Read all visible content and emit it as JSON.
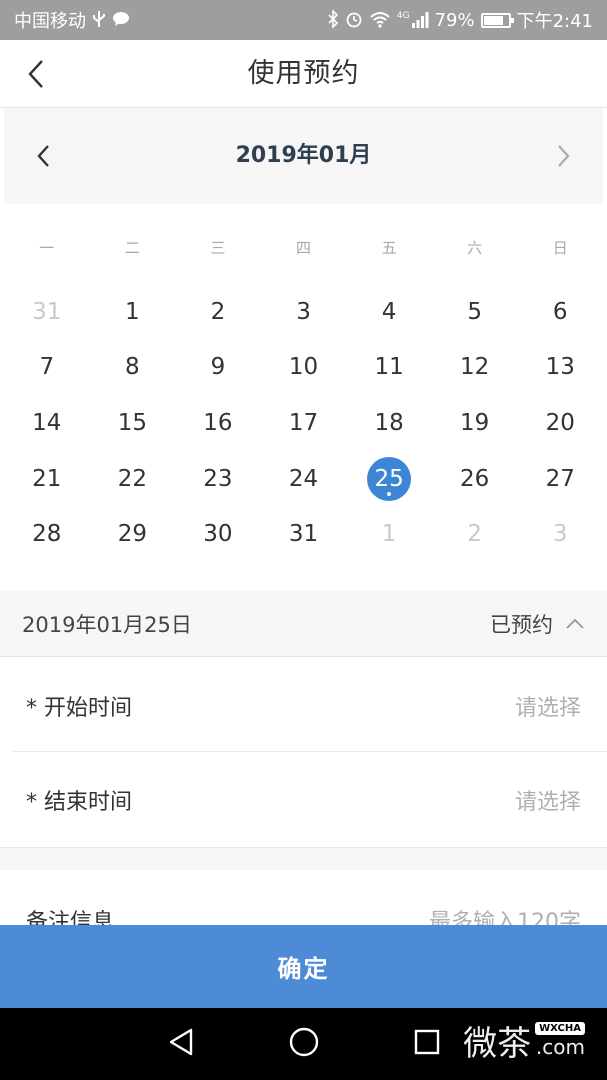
{
  "status_bar": {
    "carrier": "中国移动",
    "network": "4G",
    "battery": "79%",
    "battery_level": 0.79,
    "time": "下午2:41"
  },
  "header": {
    "title": "使用预约"
  },
  "calendar": {
    "month_title": "2019年01月",
    "weekdays": [
      "一",
      "二",
      "三",
      "四",
      "五",
      "六",
      "日"
    ],
    "weeks": [
      [
        {
          "d": "31",
          "other": true
        },
        {
          "d": "1"
        },
        {
          "d": "2"
        },
        {
          "d": "3"
        },
        {
          "d": "4"
        },
        {
          "d": "5"
        },
        {
          "d": "6"
        }
      ],
      [
        {
          "d": "7"
        },
        {
          "d": "8"
        },
        {
          "d": "9"
        },
        {
          "d": "10"
        },
        {
          "d": "11"
        },
        {
          "d": "12"
        },
        {
          "d": "13"
        }
      ],
      [
        {
          "d": "14"
        },
        {
          "d": "15"
        },
        {
          "d": "16"
        },
        {
          "d": "17"
        },
        {
          "d": "18"
        },
        {
          "d": "19"
        },
        {
          "d": "20"
        }
      ],
      [
        {
          "d": "21"
        },
        {
          "d": "22"
        },
        {
          "d": "23"
        },
        {
          "d": "24"
        },
        {
          "d": "25",
          "selected": true
        },
        {
          "d": "26"
        },
        {
          "d": "27"
        }
      ],
      [
        {
          "d": "28"
        },
        {
          "d": "29"
        },
        {
          "d": "30"
        },
        {
          "d": "31"
        },
        {
          "d": "1",
          "other": true
        },
        {
          "d": "2",
          "other": true
        },
        {
          "d": "3",
          "other": true
        }
      ]
    ]
  },
  "selected_date": {
    "label": "2019年01月25日",
    "status": "已预约"
  },
  "form": {
    "start_label": "* 开始时间",
    "start_placeholder": "请选择",
    "end_label": "* 结束时间",
    "end_placeholder": "请选择",
    "note_label": "备注信息",
    "note_placeholder": "最多输入120字"
  },
  "confirm_label": "确定",
  "watermark": {
    "text": "微茶",
    "brand": "WXCHA",
    "domain": ".com"
  },
  "colors": {
    "accent": "#3d86d6",
    "button": "#4d8bd6",
    "status_bar": "#9e9e9e",
    "muted": "#c9c9c9"
  }
}
